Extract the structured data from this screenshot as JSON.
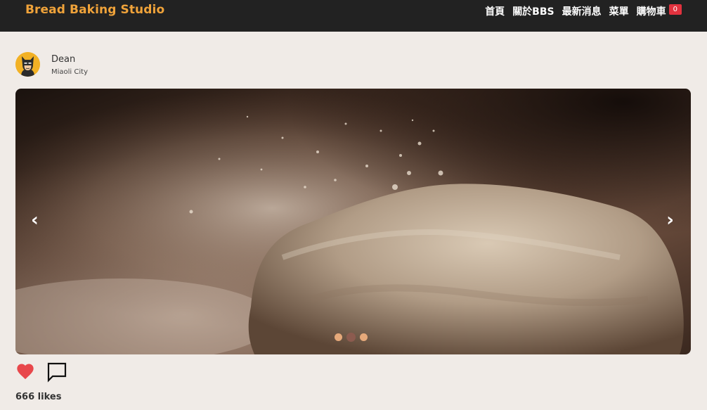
{
  "brand": "Bread Baking Studio",
  "nav": [
    {
      "label": "首頁"
    },
    {
      "label": "關於BBS"
    },
    {
      "label": "最新消息"
    },
    {
      "label": "菜單"
    },
    {
      "label": "購物車"
    }
  ],
  "cart_count": "0",
  "user": {
    "name": "Dean",
    "location": "Miaoli City"
  },
  "carousel": {
    "prev_label": "‹",
    "next_label": "›",
    "slide_count": 3,
    "active_slide": 2
  },
  "likes_text": "666 likes",
  "colors": {
    "navbar": "#222222",
    "brand": "#f0a33a",
    "badge": "#e2323e",
    "heart": "#e8474b",
    "background": "#f0ebe7"
  }
}
